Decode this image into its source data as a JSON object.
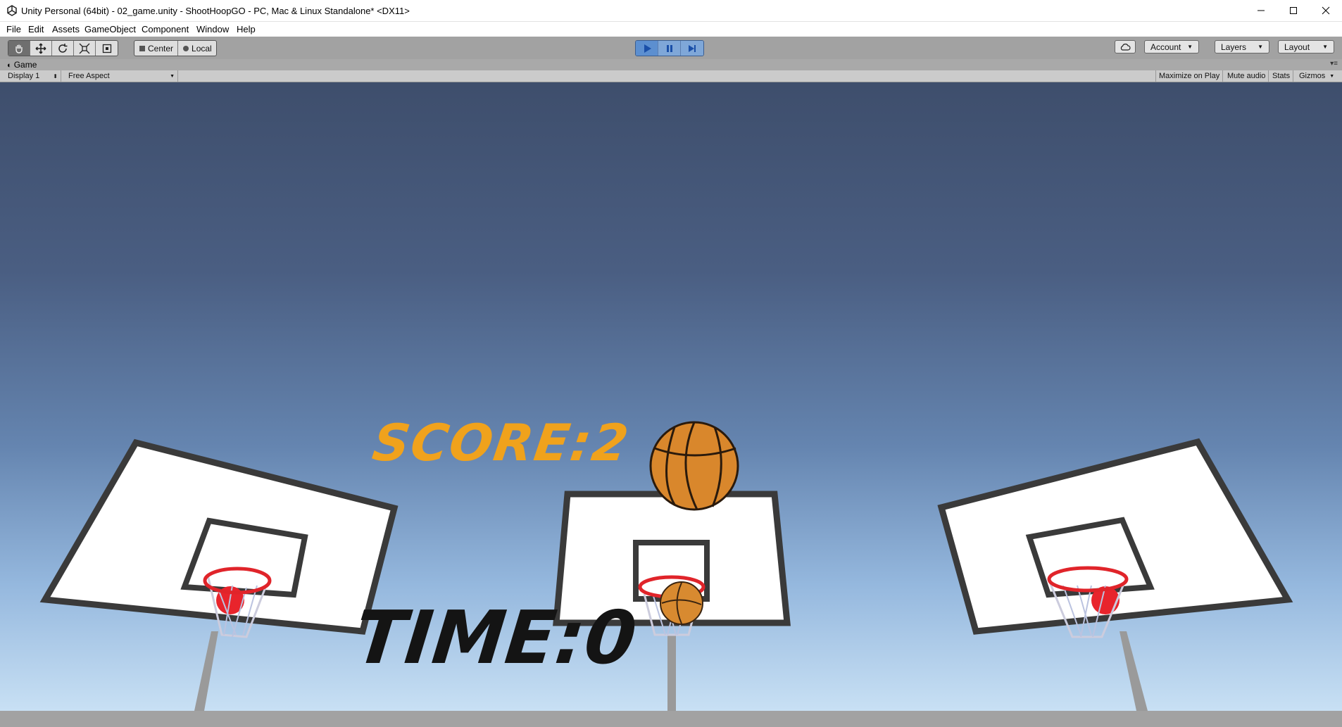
{
  "window": {
    "title": "Unity Personal (64bit) - 02_game.unity - ShootHoopGO - PC, Mac & Linux Standalone* <DX11>"
  },
  "menu": [
    "File",
    "Edit",
    "Assets",
    "GameObject",
    "Component",
    "Window",
    "Help"
  ],
  "toolbar": {
    "pivot_center": "Center",
    "pivot_local": "Local",
    "account": "Account",
    "layers": "Layers",
    "layout": "Layout"
  },
  "game_tab": {
    "label": "Game",
    "display": "Display 1",
    "aspect": "Free Aspect",
    "maximize": "Maximize on Play",
    "mute": "Mute audio",
    "stats": "Stats",
    "gizmos": "Gizmos"
  },
  "hud": {
    "score": "SCORE:2",
    "time": "TIME:0"
  },
  "colors": {
    "score_text": "#f0a21c",
    "time_text": "#141414",
    "play_active": "#5c8fd0"
  }
}
